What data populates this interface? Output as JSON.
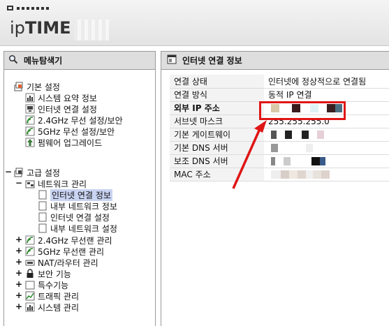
{
  "header": {
    "logo_ip": "ip",
    "logo_time": "TIME"
  },
  "menu": {
    "title": "메뉴탐색기",
    "basic": {
      "label": "기본 설정",
      "items": [
        "시스템 요약 정보",
        "인터넷 연결 설정",
        "2.4GHz 무선 설정/보안",
        "5GHz 무선 설정/보안",
        "펌웨어 업그레이드"
      ]
    },
    "advanced": {
      "label": "고급 설정",
      "network": {
        "label": "네트워크 관리",
        "items": [
          "인터넷 연결 정보",
          "내부 네트워크 정보",
          "인터넷 연결 설정",
          "내부 네트워크 설정"
        ]
      },
      "others": [
        "2.4GHz 무선랜 관리",
        "5GHz 무선랜 관리",
        "NAT/라우터 관리",
        "보안 기능",
        "특수기능",
        "트래픽 관리",
        "시스템 관리"
      ]
    }
  },
  "main": {
    "title": "인터넷 연결 정보",
    "rows": [
      {
        "key": "연결 상태",
        "value": "인터넷에 정상적으로 연결됨"
      },
      {
        "key": "연결 방식",
        "value": "동적 IP 연결"
      },
      {
        "key": "외부 IP 주소",
        "value": ""
      },
      {
        "key": "서브넷 마스크",
        "value": "255.255.255.0"
      },
      {
        "key": "기본 게이트웨이",
        "value": ""
      },
      {
        "key": "기본 DNS 서버",
        "value": ""
      },
      {
        "key": "보조 DNS 서버",
        "value": ""
      },
      {
        "key": "MAC 주소",
        "value": ""
      }
    ]
  },
  "colors": {
    "highlight": "#e01515",
    "selected": "#c9d4f2",
    "panel_header": "#dedede"
  }
}
